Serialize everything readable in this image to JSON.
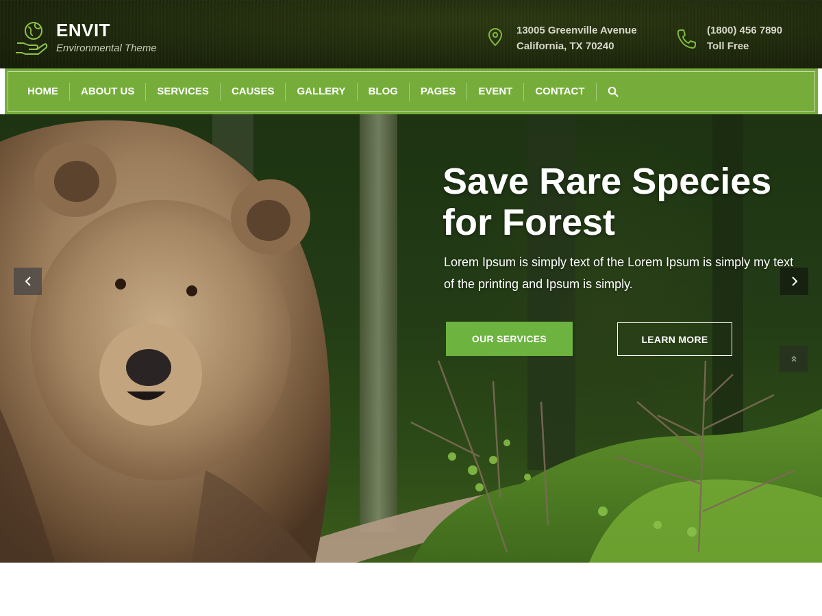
{
  "brand": {
    "name": "ENVIT",
    "tagline": "Environmental Theme"
  },
  "contact": {
    "address_line1": "13005 Greenville Avenue",
    "address_line2": "California, TX 70240",
    "phone": "(1800) 456 7890",
    "phone_note": "Toll Free"
  },
  "nav": {
    "items": [
      "HOME",
      "ABOUT US",
      "SERVICES",
      "CAUSES",
      "GALLERY",
      "BLOG",
      "PAGES",
      "EVENT",
      "CONTACT"
    ],
    "search_icon": "search-icon"
  },
  "hero": {
    "title_line1": "Save Rare Species",
    "title_line2": "for Forest",
    "text": "Lorem Ipsum is simply text of the Lorem Ipsum is simply my text of the printing and Ipsum is simply.",
    "primary_button": "OUR SERVICES",
    "secondary_button": "LEARN MORE"
  },
  "icons": {
    "prev": "chevron-left-icon",
    "next": "chevron-right-icon",
    "scroll_top": "double-chevron-up-icon",
    "address": "map-pin-icon",
    "phone": "phone-icon",
    "logo": "globe-hand-icon"
  },
  "colors": {
    "accent": "#76ad3a",
    "button_green": "#6cb33f",
    "header_bg": "#1f290c",
    "icon_green": "#7fb93e"
  }
}
